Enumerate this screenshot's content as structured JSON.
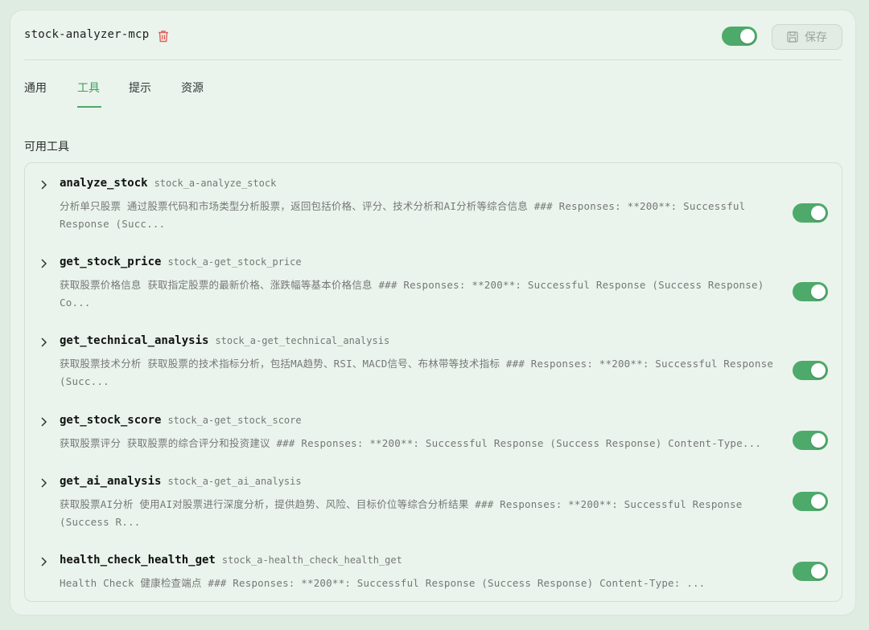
{
  "server": {
    "name": "stock-analyzer-mcp",
    "enabled": true,
    "save_label": "保存"
  },
  "tabs": [
    {
      "label": "通用",
      "active": false
    },
    {
      "label": "工具",
      "active": true
    },
    {
      "label": "提示",
      "active": false
    },
    {
      "label": "资源",
      "active": false
    }
  ],
  "section_title": "可用工具",
  "tools": [
    {
      "name": "analyze_stock",
      "id": "stock_a-analyze_stock",
      "description": "分析单只股票 通过股票代码和市场类型分析股票，返回包括价格、评分、技术分析和AI分析等综合信息 ### Responses: **200**: Successful Response (Succ...",
      "enabled": true
    },
    {
      "name": "get_stock_price",
      "id": "stock_a-get_stock_price",
      "description": "获取股票价格信息 获取指定股票的最新价格、涨跌幅等基本价格信息 ### Responses: **200**: Successful Response (Success Response) Co...",
      "enabled": true
    },
    {
      "name": "get_technical_analysis",
      "id": "stock_a-get_technical_analysis",
      "description": "获取股票技术分析 获取股票的技术指标分析，包括MA趋势、RSI、MACD信号、布林带等技术指标 ### Responses: **200**: Successful Response (Succ...",
      "enabled": true
    },
    {
      "name": "get_stock_score",
      "id": "stock_a-get_stock_score",
      "description": "获取股票评分 获取股票的综合评分和投资建议 ### Responses: **200**: Successful Response (Success Response) Content-Type...",
      "enabled": true
    },
    {
      "name": "get_ai_analysis",
      "id": "stock_a-get_ai_analysis",
      "description": "获取股票AI分析 使用AI对股票进行深度分析，提供趋势、风险、目标价位等综合分析结果 ### Responses: **200**: Successful Response (Success R...",
      "enabled": true
    },
    {
      "name": "health_check_health_get",
      "id": "stock_a-health_check_health_get",
      "description": "Health Check 健康检查端点 ### Responses: **200**: Successful Response (Success Response) Content-Type: ...",
      "enabled": true
    }
  ]
}
